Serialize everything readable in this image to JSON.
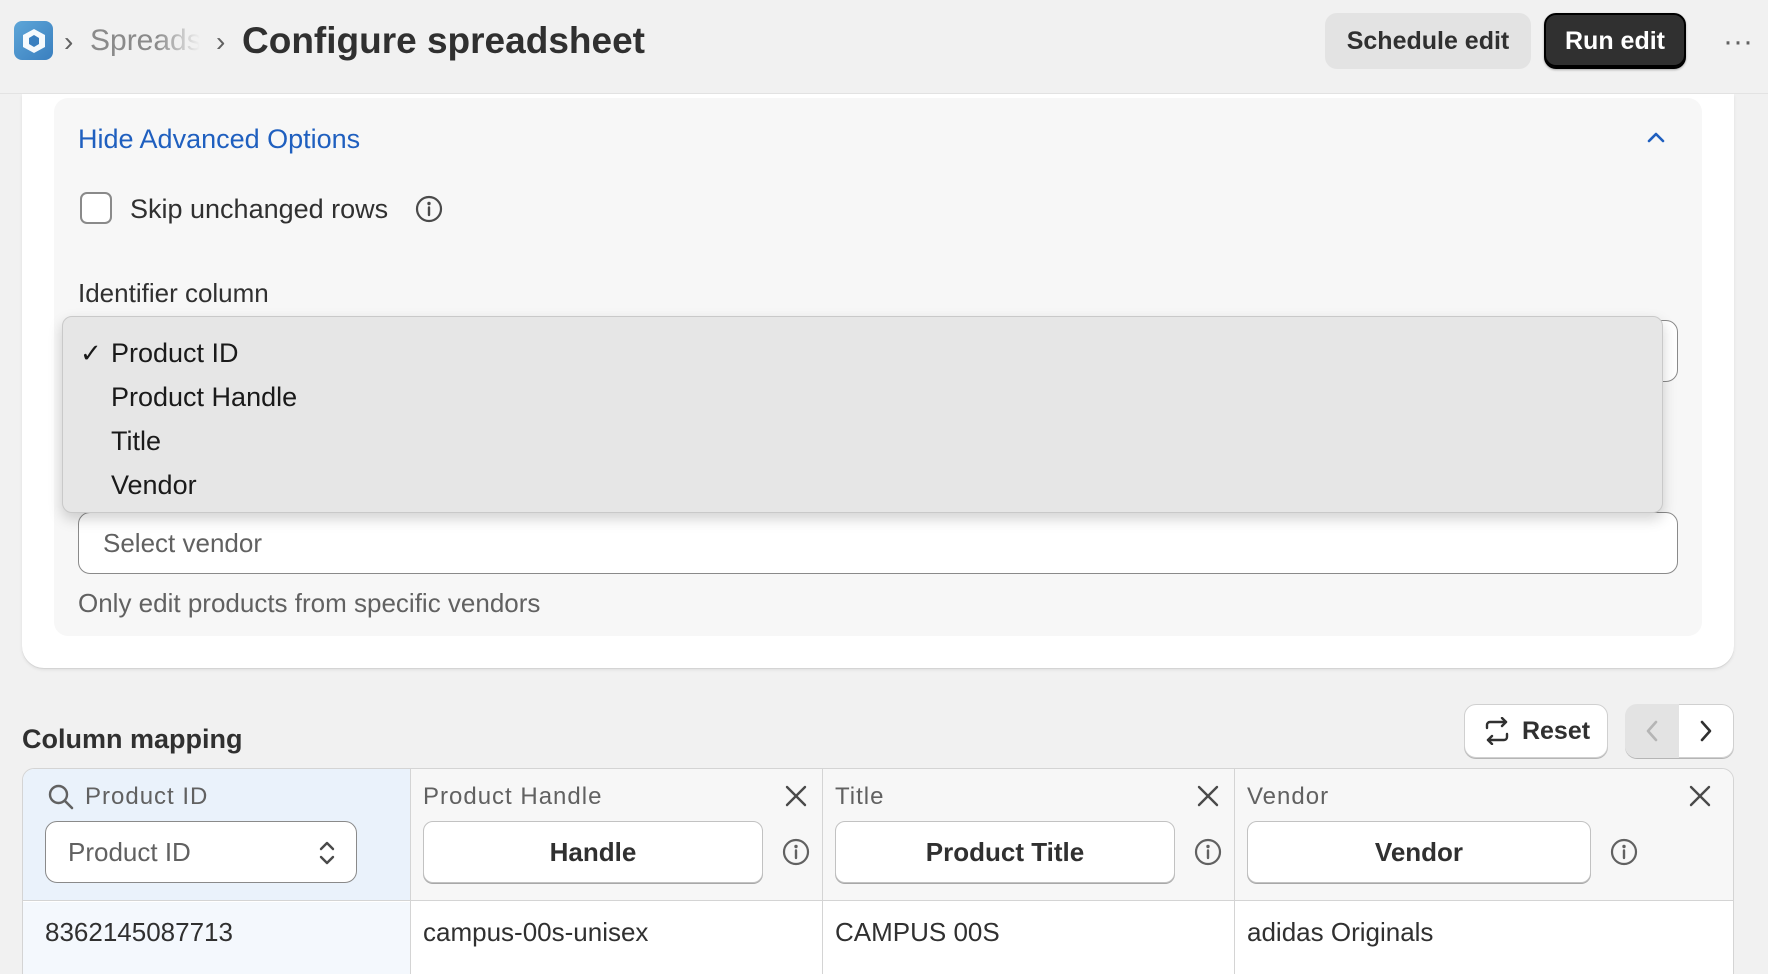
{
  "header": {
    "breadcrumb_parent": "Spreads",
    "title": "Configure spreadsheet",
    "schedule_label": "Schedule edit",
    "run_label": "Run edit",
    "more_label": "···"
  },
  "advanced": {
    "toggle_label": "Hide Advanced Options",
    "skip_unchanged_label": "Skip unchanged rows",
    "skip_unchanged_checked": false,
    "identifier_label": "Identifier column",
    "identifier_options": [
      "Product ID",
      "Product Handle",
      "Title",
      "Vendor"
    ],
    "identifier_selected": "Product ID",
    "vendor_placeholder": "Select vendor",
    "vendor_help": "Only edit products from specific vendors"
  },
  "mapping": {
    "title": "Column mapping",
    "reset_label": "Reset",
    "key_column": {
      "name": "Product ID",
      "selected": "Product ID",
      "value": "8362145087713"
    },
    "columns": [
      {
        "name": "Product Handle",
        "mapped": "Handle",
        "value": "campus-00s-unisex"
      },
      {
        "name": "Title",
        "mapped": "Product Title",
        "value": "CAMPUS 00S"
      },
      {
        "name": "Vendor",
        "mapped": "Vendor",
        "value": "adidas Originals"
      }
    ]
  },
  "colors": {
    "accent_link": "#1f5fbf",
    "primary_button": "#303030",
    "key_column_bg": "#eaf2fb"
  }
}
